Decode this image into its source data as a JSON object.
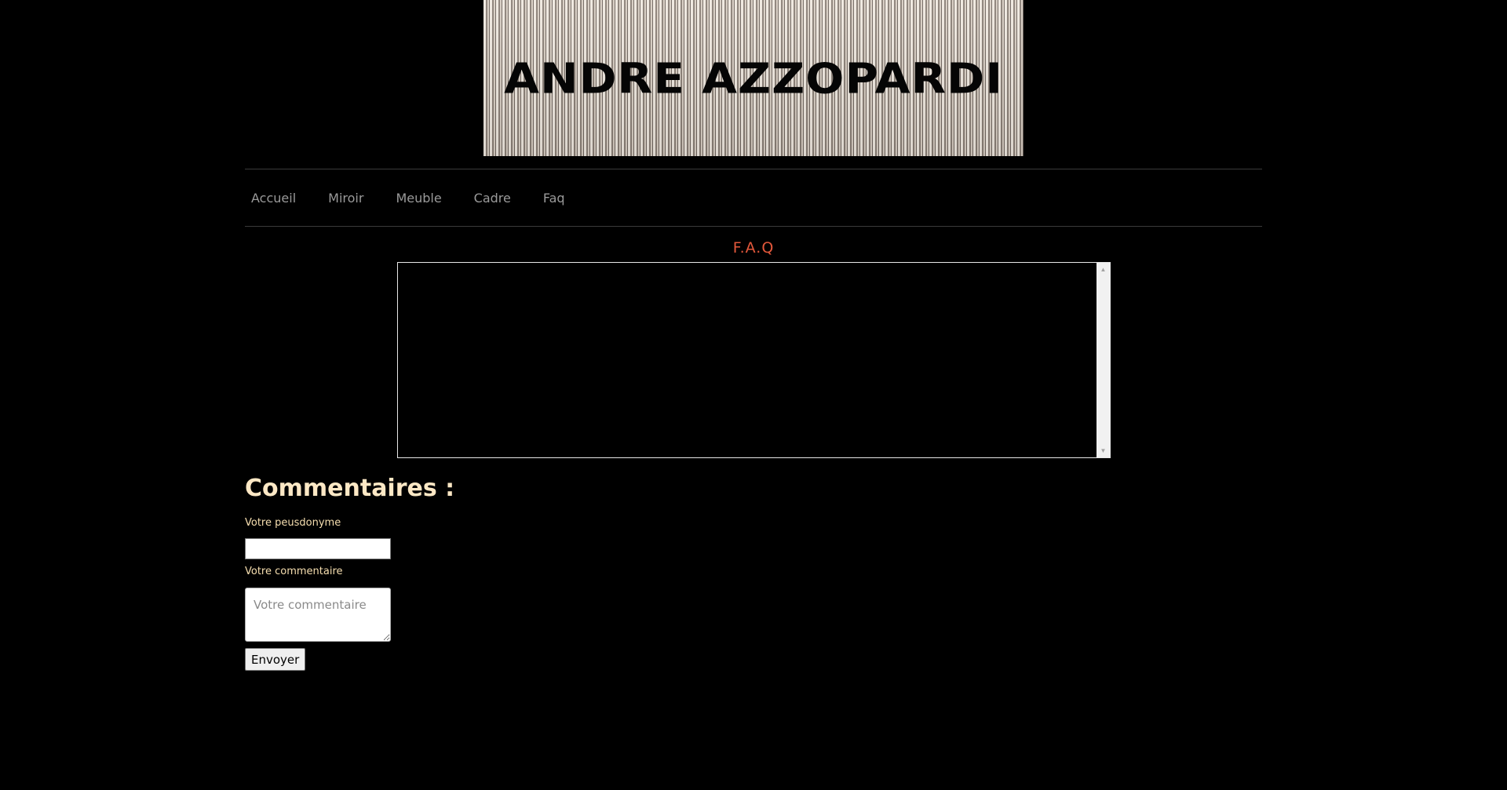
{
  "banner": {
    "title": "ANDRE AZZOPARDI"
  },
  "nav": {
    "items": [
      {
        "label": "Accueil"
      },
      {
        "label": "Miroir"
      },
      {
        "label": "Meuble"
      },
      {
        "label": "Cadre"
      },
      {
        "label": "Faq"
      }
    ]
  },
  "faq": {
    "title": "F.A.Q"
  },
  "comments": {
    "heading": "Commentaires :",
    "pseudo_label": "Votre peusdonyme",
    "pseudo_value": "",
    "comment_label": "Votre commentaire",
    "comment_placeholder": "Votre commentaire",
    "submit_label": "Envoyer"
  },
  "colors": {
    "background": "#000000",
    "faq_title": "#e4583b",
    "comments_heading": "#fde8c5",
    "labels": "#f7dfb0",
    "nav_text": "#9a9a9a"
  },
  "icons": {
    "scroll_up": "scroll-up-arrow-icon",
    "scroll_down": "scroll-down-arrow-icon"
  }
}
